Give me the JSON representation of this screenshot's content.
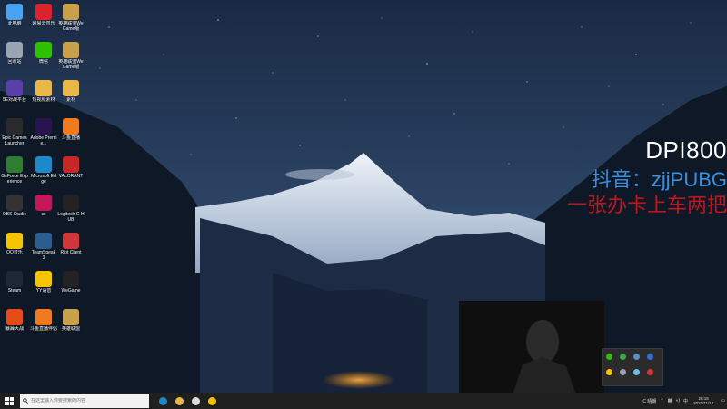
{
  "desktop": {
    "icons": [
      {
        "label": "此电脑",
        "icon": "computer-icon",
        "color": "#4aa3f0"
      },
      {
        "label": "网易云音乐",
        "icon": "netease-music-icon",
        "color": "#d9242f"
      },
      {
        "label": "英雄联盟WeGame版",
        "icon": "lol-icon",
        "color": "#c8a14a"
      },
      {
        "label": "回收站",
        "icon": "recycle-bin-icon",
        "color": "#9aa5b1"
      },
      {
        "label": "微信",
        "icon": "wechat-icon",
        "color": "#2dc100"
      },
      {
        "label": "英雄联盟WeGame版",
        "icon": "lol-icon",
        "color": "#c8a14a"
      },
      {
        "label": "5E对战平台",
        "icon": "5e-platform-icon",
        "color": "#5b3fa8"
      },
      {
        "label": "短视频素材",
        "icon": "folder-icon",
        "color": "#e8b94a"
      },
      {
        "label": "素材",
        "icon": "folder-icon",
        "color": "#e8b94a"
      },
      {
        "label": "Epic Games Launcher",
        "icon": "epic-games-icon",
        "color": "#2a2a2a"
      },
      {
        "label": "Adobe Premie...",
        "icon": "premiere-icon",
        "color": "#2a1450"
      },
      {
        "label": "斗鱼直播",
        "icon": "douyu-icon",
        "color": "#f07a1e"
      },
      {
        "label": "GeForce Experience",
        "icon": "geforce-icon",
        "color": "#2e7d32"
      },
      {
        "label": "Microsoft Edge",
        "icon": "edge-icon",
        "color": "#1e88c8"
      },
      {
        "label": "VALORANT",
        "icon": "valorant-icon",
        "color": "#c62828"
      },
      {
        "label": "OBS Studio",
        "icon": "obs-icon",
        "color": "#333"
      },
      {
        "label": "ss",
        "icon": "ss-icon",
        "color": "#c2185b"
      },
      {
        "label": "Logitech G HUB",
        "icon": "logitech-icon",
        "color": "#222"
      },
      {
        "label": "QQ音乐",
        "icon": "qq-music-icon",
        "color": "#f5c400"
      },
      {
        "label": "TeamSpeak 3",
        "icon": "teamspeak-icon",
        "color": "#2c5d8f"
      },
      {
        "label": "Riot Client",
        "icon": "riot-icon",
        "color": "#d13639"
      },
      {
        "label": "Steam",
        "icon": "steam-icon",
        "color": "#1b2838"
      },
      {
        "label": "YY语音",
        "icon": "yy-icon",
        "color": "#f5c400"
      },
      {
        "label": "WeGame",
        "icon": "wegame-icon",
        "color": "#222"
      },
      {
        "label": "暴躁大战",
        "icon": "game-icon",
        "color": "#e64a19"
      },
      {
        "label": "斗鱼直播伴侣",
        "icon": "douyu-companion-icon",
        "color": "#f07a1e"
      },
      {
        "label": "英雄联盟",
        "icon": "lol-icon",
        "color": "#c8a14a"
      }
    ]
  },
  "overlay": {
    "dpi": "DPI800",
    "douyin": "抖音：zjjPUBG",
    "slogan": "一张办卡上车两把"
  },
  "taskbar": {
    "search_placeholder": "在这里输入你要搜索的内容",
    "apps": [
      {
        "name": "edge-taskbar-icon",
        "color": "#1e88c8"
      },
      {
        "name": "file-explorer-taskbar-icon",
        "color": "#e8b94a"
      },
      {
        "name": "obs-taskbar-icon",
        "color": "#ddd"
      },
      {
        "name": "qq-music-taskbar-icon",
        "color": "#f5c400"
      }
    ],
    "tray": {
      "weather": "C 晴朗",
      "ime": "中",
      "time": "20:16",
      "date": "2021/11/13"
    }
  },
  "colors": {
    "taskbar": "#1f1f1f",
    "dpi_text": "#ffffff",
    "douyin_text": "#3b8fe0",
    "slogan_text": "#c0161c"
  }
}
